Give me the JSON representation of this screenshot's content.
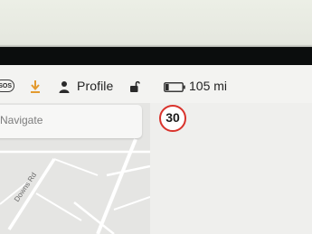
{
  "status_bar": {
    "sos_label": "SOS",
    "profile_label": "Profile",
    "range_label": "105 mi",
    "battery_level": 0.2
  },
  "navigation": {
    "search_placeholder": "Navigate"
  },
  "map": {
    "road_label": "Downs Rd"
  },
  "speed_limit": {
    "value": "30"
  },
  "colors": {
    "download_accent": "#e39a2e",
    "speed_ring": "#d9332c"
  }
}
